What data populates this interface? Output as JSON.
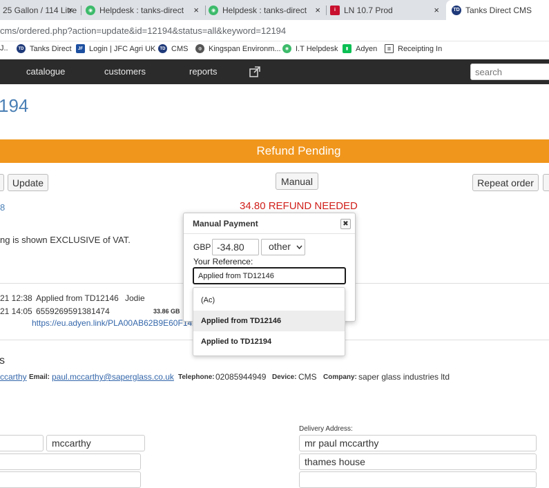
{
  "browser": {
    "tabs": [
      {
        "label": "25 Gallon / 114 Litre"
      },
      {
        "label": "Helpdesk : tanks-direct"
      },
      {
        "label": "Helpdesk : tanks-direct"
      },
      {
        "label": "LN 10.7 Prod"
      },
      {
        "label": "Tanks Direct CMS"
      }
    ],
    "close_glyph": "×",
    "url": "cms/ordered.php?action=update&id=12194&status=all&keyword=12194",
    "bookmarks": [
      {
        "label": "Tanks Direct"
      },
      {
        "label": "Login | JFC Agri UK"
      },
      {
        "label": "CMS"
      },
      {
        "label": "Kingspan Environm..."
      },
      {
        "label": "I.T Helpdesk"
      },
      {
        "label": "Adyen"
      },
      {
        "label": "Receipting In"
      }
    ]
  },
  "nav": {
    "items": [
      "catalogue",
      "customers",
      "reports"
    ],
    "search_placeholder": "search"
  },
  "order": {
    "title_fragment": "194",
    "status": "Refund Pending",
    "update_label": "Update",
    "manual_label": "Manual",
    "repeat_label": "Repeat order",
    "refund_text": "34.80 REFUND NEEDED",
    "left_digit": "8",
    "vat_note": "ng is shown EXCLUSIVE of VAT."
  },
  "payments": [
    {
      "time": "21 12:38",
      "desc": "Applied from TD12146",
      "who": "Jodie"
    },
    {
      "time": "21 14:05",
      "desc": "6559269591381474",
      "amount": "33.86 GB"
    }
  ],
  "payment_link": "https://eu.adyen.link/PLA00AB62B9E60F142",
  "customer": {
    "heading": "s",
    "name_link": "ccarthy",
    "email_label": "Email:",
    "email": "paul.mccarthy@saperglass.co.uk",
    "telephone_label": "Telephone:",
    "telephone": "02085944949",
    "device_label": "Device:",
    "device": "CMS",
    "company_label": "Company:",
    "company": "saper glass industries ltd",
    "surname": "mccarthy",
    "delivery_label": "Delivery Address:",
    "delivery_name": "mr paul mccarthy",
    "delivery_line1": "thames house"
  },
  "modal": {
    "title": "Manual Payment",
    "currency": "GBP",
    "amount": "-34.80",
    "method": "other",
    "reference_label": "Your Reference:",
    "reference_value": "Applied from TD12146",
    "options": [
      "(Ac)",
      "Applied from TD12146",
      "Applied to TD12194"
    ],
    "close_glyph": "✖"
  },
  "colors": {
    "status_bar": "#f0961c",
    "refund_red": "#d0201b",
    "title_blue": "#4a7fb5",
    "nav_bg": "#2b2b2b"
  }
}
